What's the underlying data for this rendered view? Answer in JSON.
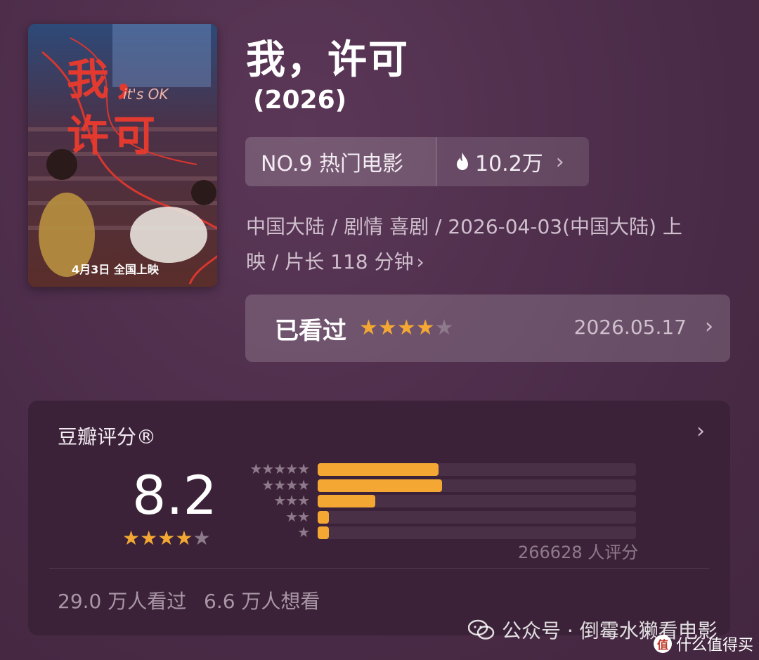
{
  "movie": {
    "title": "我，许可",
    "year": "(2026)",
    "poster": {
      "title_text": "我，许可",
      "subtitle_text": "it's OK",
      "release_text": "4月3日 全国上映"
    }
  },
  "ranking": {
    "label": "NO.9 热门电影",
    "heat": "10.2万",
    "icon": "flame-icon"
  },
  "meta": {
    "line1": "中国大陆 / 剧情 喜剧 / 2026-04-03(中国大陆) 上",
    "line2": "映 / 片长 118 分钟"
  },
  "watched": {
    "label": "已看过",
    "user_stars": 4,
    "date": "2026.05.17"
  },
  "rating": {
    "title": "豆瓣评分®",
    "score": "8.2",
    "stars": 4,
    "distribution": [
      {
        "stars": 5,
        "fraction": 0.38
      },
      {
        "stars": 4,
        "fraction": 0.39
      },
      {
        "stars": 3,
        "fraction": 0.18
      },
      {
        "stars": 2,
        "fraction": 0.035
      },
      {
        "stars": 1,
        "fraction": 0.035
      }
    ],
    "count_text": "266628 人评分",
    "watched_text": "29.0 万人看过",
    "want_text": "6.6 万人想看"
  },
  "watermark": {
    "text": "公众号 · 倒霉水獭看电影",
    "brand_badge": "值",
    "brand": "什么值得买"
  },
  "colors": {
    "accent": "#f4a833",
    "background": "#4f2f4d",
    "card": "#3b2238"
  }
}
